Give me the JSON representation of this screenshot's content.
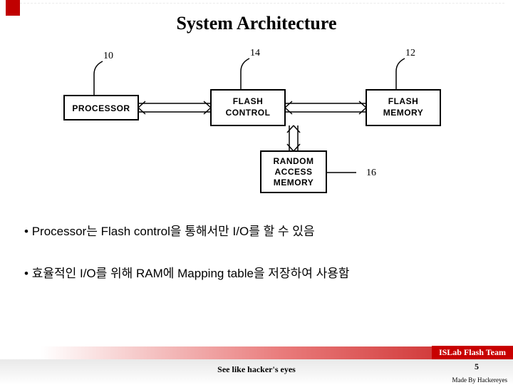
{
  "title": "System Architecture",
  "diagram": {
    "blocks": {
      "processor": {
        "label": "PROCESSOR",
        "num": "10"
      },
      "flash_control": {
        "label_l1": "FLASH",
        "label_l2": "CONTROL",
        "num": "14"
      },
      "flash_memory": {
        "label_l1": "FLASH",
        "label_l2": "MEMORY",
        "num": "12"
      },
      "ram": {
        "label_l1": "RANDOM",
        "label_l2": "ACCESS",
        "label_l3": "MEMORY",
        "num": "16"
      }
    }
  },
  "bullets": [
    "Processor는 Flash control을 통해서만 I/O를 할 수 있음",
    "효율적인 I/O를 위해 RAM에 Mapping table을 저장하여 사용함"
  ],
  "footer": {
    "team": "ISLab Flash Team",
    "tagline": "See like hacker's eyes",
    "made_by": "Made By Hackereyes",
    "page": "5"
  },
  "colors": {
    "accent": "#c00000"
  }
}
